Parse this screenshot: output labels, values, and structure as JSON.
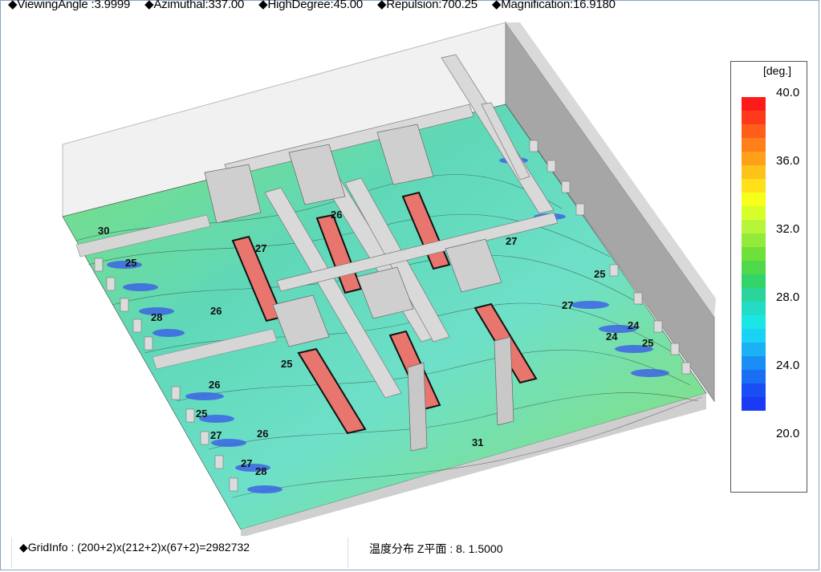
{
  "header": {
    "viewing_angle": "◆ViewingAngle :3.9999",
    "azimuthal": "◆Azimuthal:337.00",
    "high_degree": "◆HighDegree:45.00",
    "repulsion": "◆Repulsion:700.25",
    "magnification": "◆Magnification:16.9180"
  },
  "footer": {
    "grid_info": "◆GridInfo : (200+2)x(212+2)x(67+2)=2982732",
    "plane_info": "温度分布 Z平面 : 8. 1.5000"
  },
  "legend": {
    "unit": "[deg.]",
    "labels": [
      "40.0",
      "36.0",
      "32.0",
      "28.0",
      "24.0",
      "20.0"
    ],
    "colors": [
      "#ff1a1a",
      "#ff3a1a",
      "#ff5e1a",
      "#ff7f1a",
      "#ffa01a",
      "#ffc21a",
      "#ffe01a",
      "#f6ff1a",
      "#d6ff2a",
      "#b6f53a",
      "#94ea3a",
      "#6fe03a",
      "#4fd84a",
      "#32d46a",
      "#2ad49a",
      "#22dcc6",
      "#1ae6e6",
      "#1ad2f4",
      "#1ab2f4",
      "#1a8ef4",
      "#1a6ef4",
      "#1a4ef4",
      "#1a3af4"
    ]
  },
  "contour_labels": [
    "30",
    "26",
    "27",
    "28",
    "25",
    "25",
    "24",
    "26",
    "27",
    "31",
    "25",
    "27",
    "27",
    "24",
    "25",
    "26",
    "27",
    "26",
    "28",
    "25"
  ]
}
